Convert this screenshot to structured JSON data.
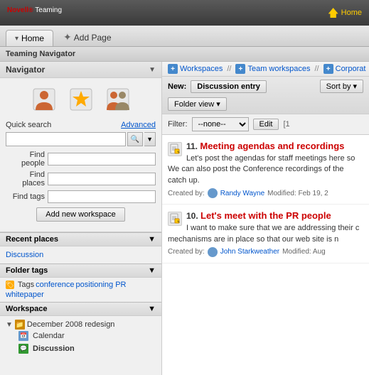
{
  "header": {
    "logo": "Novell",
    "logo_dot": "®",
    "logo_suffix": " Teaming",
    "home_label": "Home"
  },
  "tabs": {
    "home_tab": "Home",
    "home_arrow": "▾",
    "add_page": "Add Page"
  },
  "teaming_navigator": "Teaming Navigator",
  "navigator": {
    "title": "Navigator",
    "quick_search_label": "Quick search",
    "advanced_label": "Advanced",
    "find_people_label": "Find people",
    "find_places_label": "Find places",
    "find_tags_label": "Find tags",
    "add_workspace_label": "Add new workspace",
    "search_placeholder": ""
  },
  "recent_places": {
    "title": "Recent places",
    "items": [
      "Discussion"
    ]
  },
  "folder_tags": {
    "title": "Folder tags",
    "tags_prefix": "Tags",
    "tags": [
      "conference",
      "positioning PR",
      "whitepaper"
    ]
  },
  "workspace": {
    "title": "Workspace",
    "root": "December 2008 redesign",
    "children": [
      "Calendar",
      "Discussion"
    ]
  },
  "breadcrumb": {
    "items": [
      "Workspaces",
      "Team workspaces",
      "Corporat"
    ]
  },
  "toolbar": {
    "new_label": "New:",
    "new_btn": "Discussion entry",
    "sort_by": "Sort by",
    "folder_view": "Folder view"
  },
  "filter": {
    "label": "Filter:",
    "value": "--none--",
    "edit_btn": "Edit",
    "count": "[1"
  },
  "entries": [
    {
      "number": "11.",
      "title": "Meeting agendas and recordings",
      "body": "Let's post the agendas for staff meetings here so We can also post the Conference recordings of the catch up.",
      "created_by": "Created by:",
      "author": "Randy Wayne",
      "modified": "Modified: Feb 19, 2"
    },
    {
      "number": "10.",
      "title": "Let's meet with the PR people",
      "body": "I want to make sure that we are addressing their c mechanisms are in place so that our web site is n",
      "created_by": "Created by:",
      "author": "John Starkweather",
      "modified": "Modified: Aug"
    }
  ]
}
